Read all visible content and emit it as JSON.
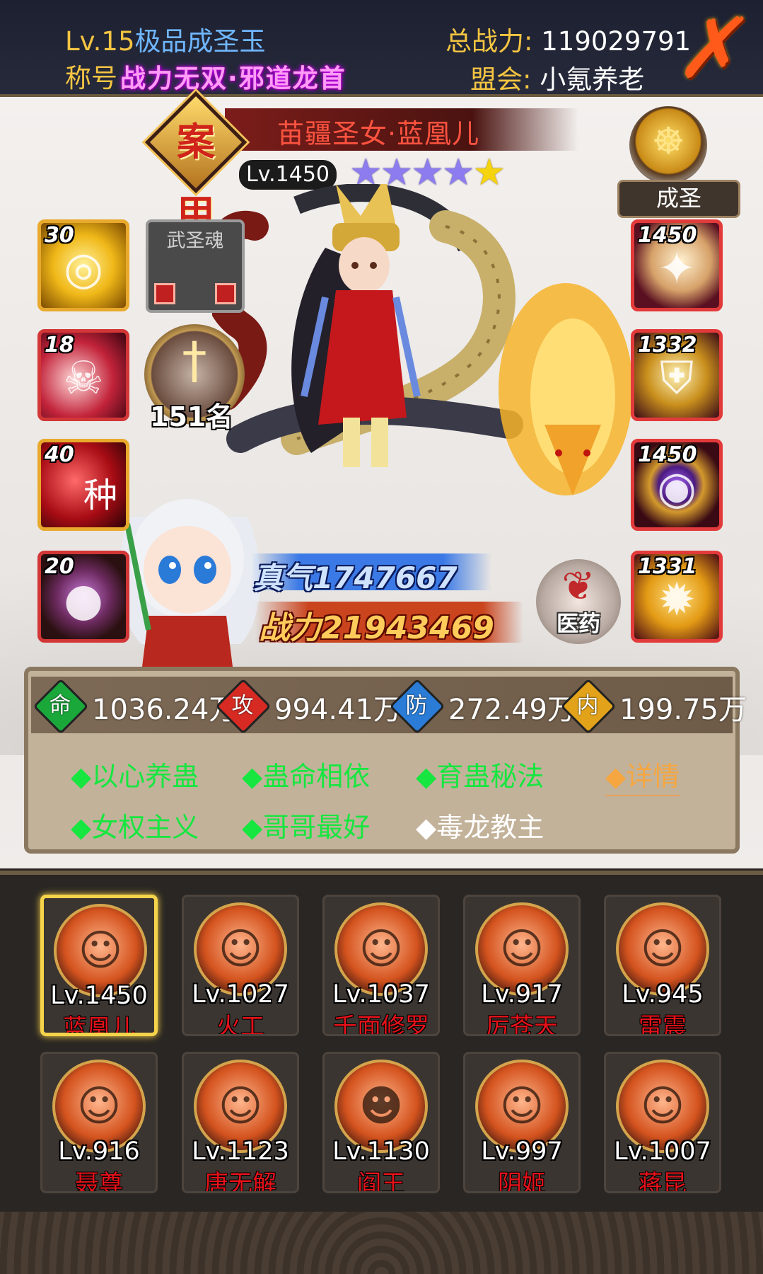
{
  "header": {
    "level": "Lv.15",
    "rank_name": "极品成圣玉",
    "title_label": "称号",
    "title_value": "战力无双·邪道龙首",
    "power_label": "总战力:",
    "power_value": "119029791",
    "guild_label": "盟会:",
    "guild_value": "小氪养老",
    "close_icon": "close-x-icon"
  },
  "hero": {
    "quality": "案甲",
    "name": "苗疆圣女·蓝凰儿",
    "level": "Lv.1450",
    "stars": [
      "purple",
      "purple",
      "purple",
      "purple",
      "gold"
    ],
    "realm_label": "成圣",
    "qi": "真气1747667",
    "combat_power": "战力21943469",
    "medicine_label": "医药",
    "ranking": "151名"
  },
  "skills": [
    {
      "num": "30",
      "glyph": "◎"
    },
    {
      "num": "18",
      "glyph": "☠"
    },
    {
      "num": "40",
      "glyph": "种"
    },
    {
      "num": "20",
      "glyph": "●"
    }
  ],
  "soul_slot": {
    "label": "武圣魂"
  },
  "equipment": [
    {
      "num": "1450",
      "glyph": "✦"
    },
    {
      "num": "1332",
      "glyph": "⛨"
    },
    {
      "num": "1450",
      "glyph": "◉"
    },
    {
      "num": "1331",
      "glyph": "✹"
    }
  ],
  "stats": [
    {
      "icon": "命",
      "value": "1036.24万",
      "color": "#1aa83a"
    },
    {
      "icon": "攻",
      "value": "994.41万",
      "color": "#d62a22"
    },
    {
      "icon": "防",
      "value": "272.49万",
      "color": "#2a7cd6"
    },
    {
      "icon": "内",
      "value": "199.75万",
      "color": "#e2a21a"
    }
  ],
  "traits": {
    "t1": "◆以心养蛊",
    "t2": "◆蛊命相依",
    "t3": "◆育蛊秘法",
    "t4": "◆女权主义",
    "t5": "◆哥哥最好",
    "t6": "◆毒龙教主",
    "details": "◆详情"
  },
  "roster": [
    {
      "level": "Lv.1450",
      "name": "蓝凰儿",
      "selected": true
    },
    {
      "level": "Lv.1027",
      "name": "火工"
    },
    {
      "level": "Lv.1037",
      "name": "千面修罗"
    },
    {
      "level": "Lv.917",
      "name": "厉苍天"
    },
    {
      "level": "Lv.945",
      "name": "雷震"
    },
    {
      "level": "Lv.916",
      "name": "聂尊"
    },
    {
      "level": "Lv.1123",
      "name": "唐无解"
    },
    {
      "level": "Lv.1130",
      "name": "阎王"
    },
    {
      "level": "Lv.997",
      "name": "阴姬"
    },
    {
      "level": "Lv.1007",
      "name": "蒋昆"
    }
  ]
}
